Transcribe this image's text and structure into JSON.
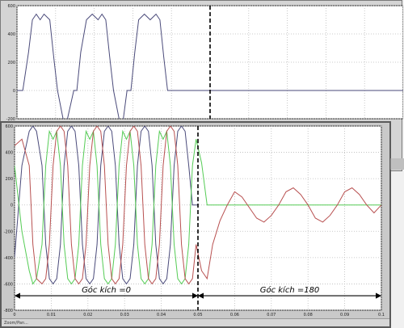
{
  "status_bar": {
    "text": "Zoom/Pan..."
  },
  "chart_data": [
    {
      "type": "line",
      "title": "",
      "xlabel": "",
      "ylabel": "",
      "xlim": [
        0,
        0.1
      ],
      "ylim": [
        -200,
        600
      ],
      "grid": true,
      "y_ticks": [
        {
          "value": 600,
          "label": "600"
        },
        {
          "value": 400,
          "label": "400"
        },
        {
          "value": 200,
          "label": "200"
        },
        {
          "value": 0,
          "label": "0"
        },
        {
          "value": -200,
          "label": "-200"
        }
      ],
      "series": [
        {
          "color": "#4a4a7a",
          "description": "output voltage waveform, active until switch time",
          "x": [
            0.0,
            0.0015,
            0.003,
            0.004,
            0.005,
            0.006,
            0.007,
            0.0085,
            0.0095,
            0.0105,
            0.012,
            0.013,
            0.0147,
            0.0155,
            0.0165,
            0.018,
            0.0195,
            0.021,
            0.022,
            0.023,
            0.024,
            0.025,
            0.0265,
            0.0275,
            0.0285,
            0.0295,
            0.0305,
            0.0315,
            0.033,
            0.0345,
            0.036,
            0.037,
            0.038,
            0.039,
            0.04,
            0.0415,
            0.0425,
            0.0435,
            0.0445,
            0.0455,
            0.0465,
            0.048,
            0.049,
            0.05,
            0.1
          ],
          "y": [
            0,
            0,
            270,
            500,
            540,
            500,
            540,
            500,
            240,
            0,
            -210,
            -210,
            0,
            0,
            270,
            500,
            540,
            500,
            540,
            500,
            240,
            0,
            -210,
            -210,
            0,
            0,
            270,
            500,
            540,
            500,
            540,
            500,
            240,
            0,
            0,
            0,
            0,
            0,
            0,
            0,
            0,
            0,
            0,
            0,
            0
          ]
        }
      ]
    },
    {
      "type": "line",
      "title": "",
      "xlabel": "",
      "ylabel": "",
      "xlim": [
        0,
        0.1
      ],
      "ylim": [
        -800,
        600
      ],
      "grid": true,
      "x_ticks": [
        {
          "value": 0,
          "label": "0"
        },
        {
          "value": 0.01,
          "label": "0.01"
        },
        {
          "value": 0.02,
          "label": "0.02"
        },
        {
          "value": 0.03,
          "label": "0.03"
        },
        {
          "value": 0.04,
          "label": "0.04"
        },
        {
          "value": 0.05,
          "label": "0.05"
        },
        {
          "value": 0.06,
          "label": "0.06"
        },
        {
          "value": 0.07,
          "label": "0.07"
        },
        {
          "value": 0.08,
          "label": "0.08"
        },
        {
          "value": 0.09,
          "label": "0.09"
        },
        {
          "value": 0.1,
          "label": "0.1"
        }
      ],
      "y_ticks": [
        {
          "value": 600,
          "label": "600"
        },
        {
          "value": 400,
          "label": "400"
        },
        {
          "value": 200,
          "label": "200"
        },
        {
          "value": 0,
          "label": "0"
        },
        {
          "value": -200,
          "label": "-200"
        },
        {
          "value": -400,
          "label": "-400"
        },
        {
          "value": -600,
          "label": "-600"
        },
        {
          "value": -800,
          "label": "-800"
        }
      ],
      "switch_time": 0.05,
      "annotations": [
        {
          "text": "Góc kích =0",
          "x_from": 0,
          "x_to": 0.05
        },
        {
          "text": "Góc kích =180",
          "x_from": 0.05,
          "x_to": 0.1
        }
      ],
      "series": [
        {
          "color": "#4a4a7a",
          "x": [
            0.0,
            0.002,
            0.004,
            0.005,
            0.006,
            0.0075,
            0.0085,
            0.0095,
            0.0105,
            0.0115,
            0.0125,
            0.0135,
            0.0145,
            0.0155,
            0.0165,
            0.0175,
            0.0185,
            0.0195,
            0.0205,
            0.0215,
            0.0225,
            0.0235,
            0.0245,
            0.0255,
            0.0265,
            0.0275,
            0.0285,
            0.0295,
            0.0305,
            0.0315,
            0.0325,
            0.0335,
            0.0345,
            0.0355,
            0.0365,
            0.0375,
            0.0385,
            0.0395,
            0.0405,
            0.0415,
            0.0425,
            0.0435,
            0.0445,
            0.0455,
            0.0465,
            0.0475,
            0.0485,
            0.05
          ],
          "y": [
            -400,
            300,
            560,
            600,
            560,
            300,
            -300,
            -560,
            -600,
            -560,
            -300,
            300,
            560,
            600,
            560,
            300,
            -300,
            -560,
            -600,
            -560,
            -300,
            300,
            560,
            600,
            560,
            300,
            -300,
            -560,
            -600,
            -560,
            -300,
            300,
            560,
            600,
            560,
            300,
            -300,
            -560,
            -600,
            -560,
            -300,
            300,
            560,
            600,
            560,
            300,
            0,
            0
          ]
        },
        {
          "color": "#55cc55",
          "x": [
            0.0,
            0.002,
            0.004,
            0.005,
            0.006,
            0.0075,
            0.0085,
            0.0095,
            0.0105,
            0.0115,
            0.0125,
            0.0135,
            0.0145,
            0.0155,
            0.0165,
            0.0175,
            0.0185,
            0.0195,
            0.0205,
            0.0215,
            0.0225,
            0.0235,
            0.0245,
            0.0255,
            0.0265,
            0.0275,
            0.0285,
            0.0295,
            0.0305,
            0.0315,
            0.0325,
            0.0335,
            0.0345,
            0.0355,
            0.0365,
            0.0375,
            0.0385,
            0.0395,
            0.0405,
            0.0415,
            0.0425,
            0.0435,
            0.0445,
            0.0455,
            0.0465,
            0.0475,
            0.0485,
            0.0495,
            0.051,
            0.0525,
            0.054,
            0.056,
            0.058,
            0.06,
            0.1
          ],
          "y": [
            300,
            -200,
            -500,
            -600,
            -560,
            -300,
            300,
            560,
            500,
            560,
            300,
            -300,
            -560,
            -600,
            -560,
            -300,
            300,
            560,
            500,
            560,
            300,
            -300,
            -560,
            -600,
            -560,
            -300,
            300,
            560,
            500,
            560,
            300,
            -300,
            -560,
            -600,
            -560,
            -300,
            300,
            560,
            500,
            560,
            300,
            -300,
            -560,
            -600,
            -560,
            -300,
            300,
            500,
            320,
            0,
            0,
            0,
            0,
            0,
            0
          ]
        },
        {
          "color": "#b85050",
          "x": [
            0.0,
            0.002,
            0.004,
            0.005,
            0.006,
            0.0075,
            0.0085,
            0.0095,
            0.0105,
            0.0115,
            0.0125,
            0.0135,
            0.0145,
            0.0155,
            0.0165,
            0.0175,
            0.0185,
            0.0195,
            0.0205,
            0.0215,
            0.0225,
            0.0235,
            0.0245,
            0.0255,
            0.0265,
            0.0275,
            0.0285,
            0.0295,
            0.0305,
            0.0315,
            0.0325,
            0.0335,
            0.0345,
            0.0355,
            0.0365,
            0.0375,
            0.0385,
            0.0395,
            0.0405,
            0.0415,
            0.0425,
            0.0435,
            0.0445,
            0.0455,
            0.0465,
            0.0475,
            0.0485,
            0.0495,
            0.051,
            0.0525,
            0.054,
            0.056,
            0.058,
            0.06,
            0.062,
            0.064,
            0.066,
            0.068,
            0.07,
            0.072,
            0.074,
            0.076,
            0.078,
            0.08,
            0.082,
            0.084,
            0.086,
            0.088,
            0.09,
            0.092,
            0.094,
            0.096,
            0.098,
            0.1
          ],
          "y": [
            450,
            500,
            300,
            -300,
            -560,
            -600,
            -560,
            -300,
            300,
            560,
            600,
            560,
            300,
            -300,
            -560,
            -600,
            -560,
            -300,
            300,
            560,
            600,
            560,
            300,
            -300,
            -560,
            -600,
            -560,
            -300,
            300,
            560,
            600,
            560,
            300,
            -300,
            -560,
            -600,
            -560,
            -300,
            300,
            560,
            600,
            560,
            300,
            -300,
            -560,
            -600,
            -560,
            -300,
            -500,
            -560,
            -300,
            -120,
            0,
            100,
            60,
            -20,
            -100,
            -130,
            -80,
            0,
            100,
            130,
            80,
            0,
            -100,
            -130,
            -80,
            0,
            100,
            130,
            80,
            0,
            -60,
            0
          ]
        }
      ]
    }
  ]
}
